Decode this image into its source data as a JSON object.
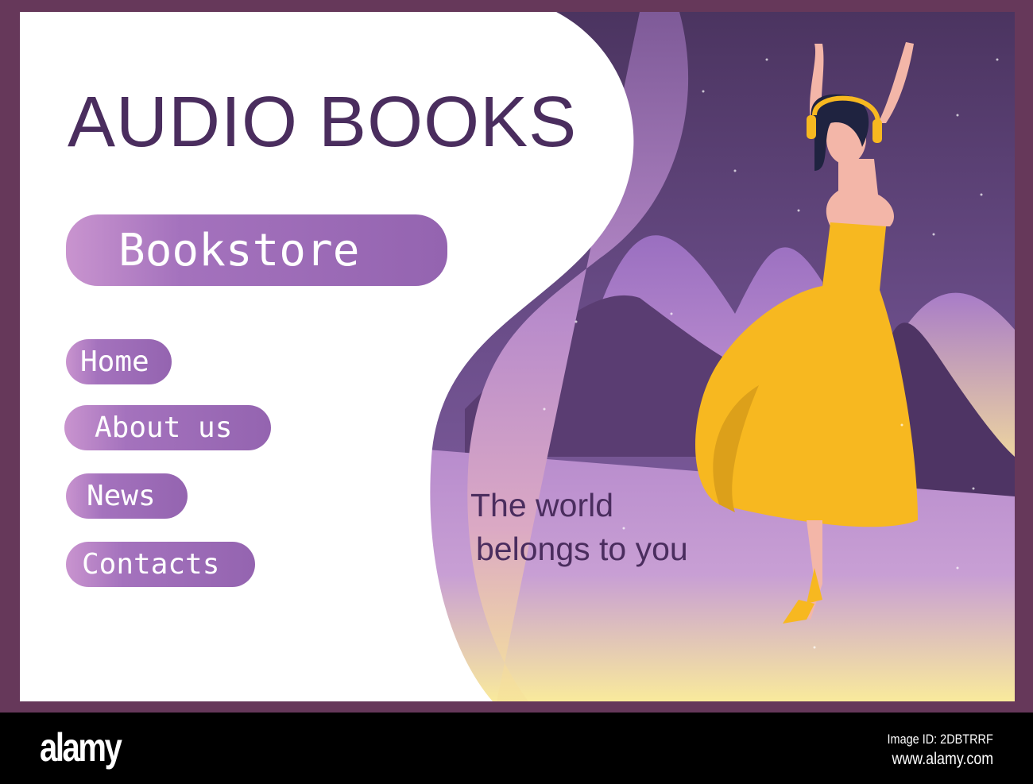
{
  "header": {
    "title": "AUDIO BOOKS"
  },
  "buttons": {
    "bookstore": "Bookstore"
  },
  "nav": {
    "items": [
      {
        "label": "Home"
      },
      {
        "label": "About us"
      },
      {
        "label": "News"
      },
      {
        "label": "Contacts"
      }
    ]
  },
  "hero": {
    "tagline_line1": "The world",
    "tagline_line2": "belongs to you"
  },
  "footer": {
    "logo": "alamy",
    "image_id": "Image ID: 2DBTRRF",
    "url": "www.alamy.com"
  },
  "watermark": "alamy",
  "colors": {
    "frame": "#66385a",
    "title": "#4a2d5e",
    "pill_start": "#c994cf",
    "pill_end": "#9464b0",
    "dress": "#f7b820"
  }
}
